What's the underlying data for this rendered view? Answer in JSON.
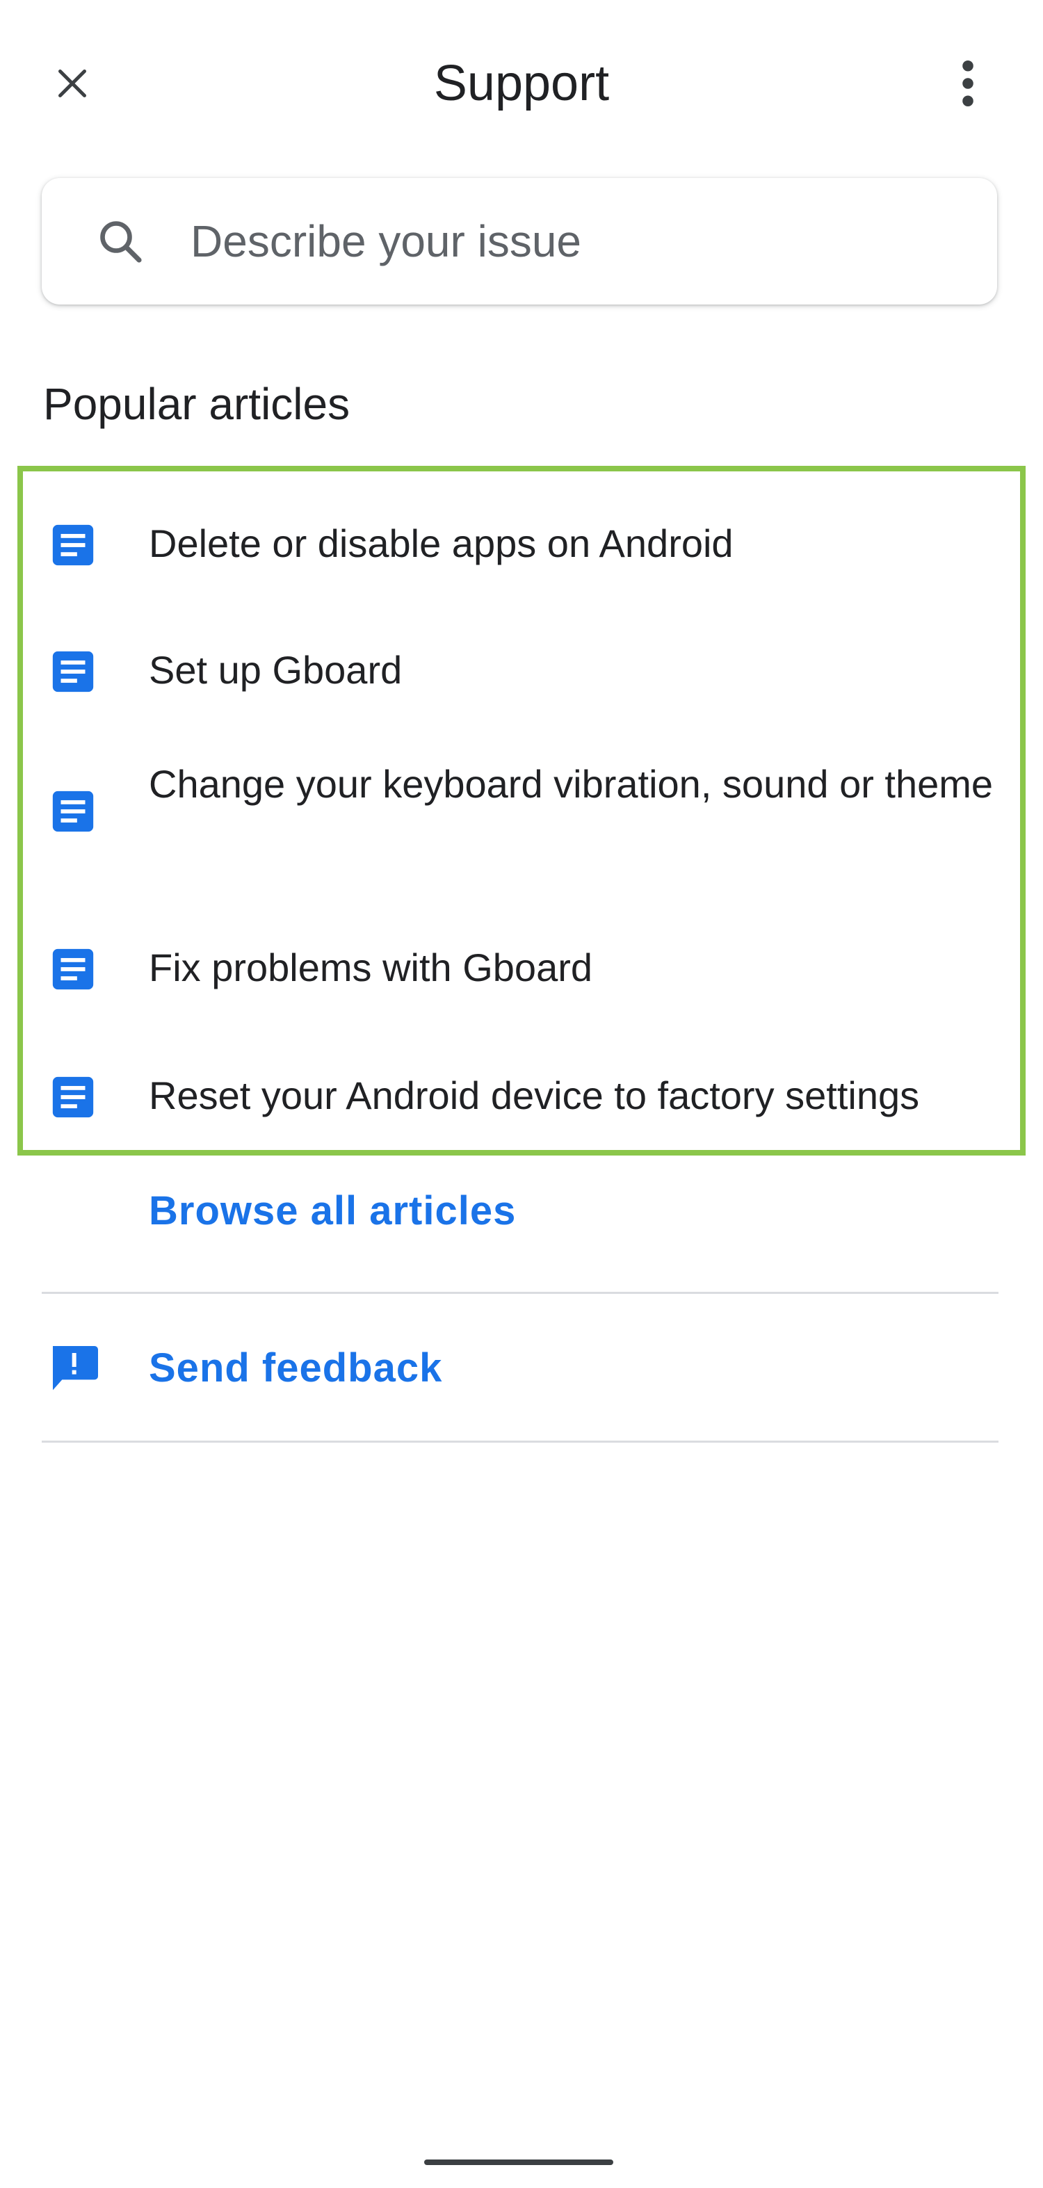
{
  "app_bar": {
    "title": "Support",
    "close_icon": "close-icon",
    "more_icon": "more-vertical-icon"
  },
  "search": {
    "placeholder": "Describe your issue",
    "value": "",
    "icon": "search-icon"
  },
  "popular": {
    "heading": "Popular articles",
    "article_icon": "article-document-icon",
    "highlight_color": "#8bc64a",
    "articles": [
      {
        "label": "Delete or disable apps on Android"
      },
      {
        "label": "Set up Gboard"
      },
      {
        "label": "Change your keyboard vibration, sound or theme"
      },
      {
        "label": "Fix problems with Gboard"
      },
      {
        "label": "Reset your Android device to factory settings"
      }
    ],
    "browse_all_label": "Browse all articles"
  },
  "feedback": {
    "label": "Send feedback",
    "icon": "feedback-alert-icon"
  },
  "colors": {
    "accent": "#1a73e8",
    "icon_blue": "#1a73e8",
    "text_primary": "#202124",
    "text_secondary": "#5f6368",
    "divider": "#dadce0"
  }
}
